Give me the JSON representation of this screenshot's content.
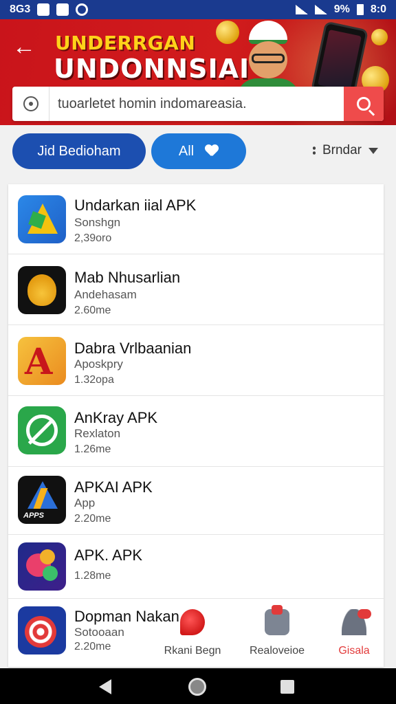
{
  "status_bar": {
    "left_text": "8G3",
    "battery_text": "9%",
    "right_text": "8:0"
  },
  "header": {
    "back_icon": "arrow-left-icon",
    "brand_top": "UNDERRGAN",
    "brand_main": "UNDONNSIAI"
  },
  "search": {
    "placeholder": "tuoarletet homin indomareasia.",
    "lead_icon": "circle-icon",
    "button_icon": "search-icon"
  },
  "filters": {
    "pill_1": "Jid Bedioham",
    "pill_2": "All",
    "pill_2_icon": "heart-icon",
    "sort_label": "Brndar"
  },
  "apps": [
    {
      "name": "Undarkan iial APK",
      "subtitle": "Sonshgn",
      "size": "2,39oro"
    },
    {
      "name": "Mab Nhusarlian",
      "subtitle": "Andehasam",
      "size": "2.60me"
    },
    {
      "name": "Dabra Vrlbaanian",
      "subtitle": "Aposkpry",
      "size": "1.32opa"
    },
    {
      "name": "AnKray APK",
      "subtitle": "Rexlaton",
      "size": "1.26me"
    },
    {
      "name": "APKAI APK",
      "subtitle": "App",
      "size": "2.20me",
      "icon_tag": "APPS"
    },
    {
      "name": "APK. APK",
      "subtitle": "",
      "size": "1.28me"
    },
    {
      "name": "Dopman Nakan",
      "subtitle": "Sotooaan",
      "size": "2.20me"
    }
  ],
  "bottom_tabs": [
    {
      "label": "Rkani Begn"
    },
    {
      "label": "Realoveioe"
    },
    {
      "label": "Gisala"
    }
  ],
  "colors": {
    "status_bar": "#1a3a8f",
    "header_red": "#d21c1c",
    "search_button": "#ef4b4b",
    "pill_dark_blue": "#1c4fb0",
    "pill_blue": "#1e78d8",
    "active_tab": "#e23a3a"
  }
}
